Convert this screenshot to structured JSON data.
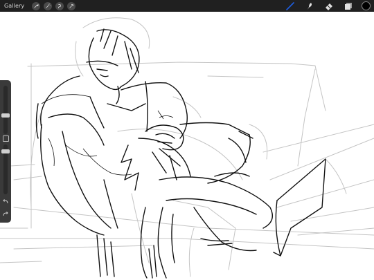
{
  "topbar": {
    "gallery_label": "Gallery",
    "left_tools": [
      "wrench-icon",
      "magic-wand-icon",
      "selection-icon",
      "transform-icon"
    ],
    "right_tools": [
      "brush-icon",
      "smudge-icon",
      "eraser-icon",
      "layers-icon"
    ],
    "active_tool": "brush-icon",
    "active_color": "#1e5bd6",
    "current_color": "#000000"
  },
  "sidebar": {
    "brush_size": 0.72,
    "opacity": 0.72,
    "buttons": [
      "modify-icon",
      "undo-icon",
      "redo-icon"
    ]
  }
}
